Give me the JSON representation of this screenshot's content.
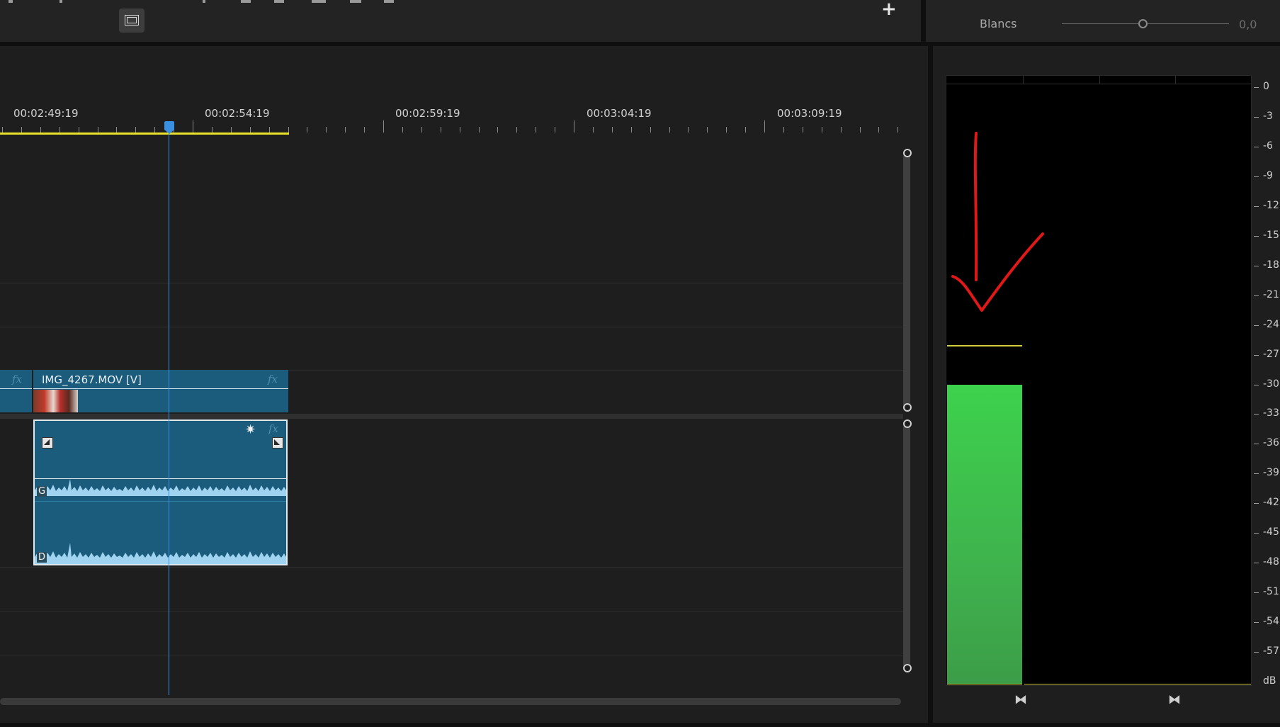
{
  "top_bar": {
    "add_button": "+",
    "lumetri_param": {
      "label": "Blancs",
      "value": "0,0"
    }
  },
  "timeline": {
    "ruler_labels": [
      "00:02:49:19",
      "00:02:54:19",
      "00:02:59:19",
      "00:03:04:19",
      "00:03:09:19"
    ],
    "video_clip": {
      "name": "IMG_4267.MOV [V]",
      "fx_prev": "fx",
      "fx": "fx"
    },
    "audio_clip": {
      "channel_left": "G",
      "channel_right": "D",
      "fx": "fx"
    }
  },
  "audio_meter": {
    "scale_labels": [
      "0",
      "-3",
      "-6",
      "-9",
      "-12",
      "-15",
      "-18",
      "-21",
      "-24",
      "-27",
      "-30",
      "-33",
      "-36",
      "-39",
      "-42",
      "-45",
      "-48",
      "-51",
      "-54",
      "-57",
      "dB"
    ],
    "left_channel_level_db": -30,
    "left_channel_peak_db": -26,
    "right_channel_level_db": null,
    "colors": {
      "level": "#3fcf4f",
      "peak": "#d4cc3a",
      "annotation": "#e01818"
    }
  },
  "colors": {
    "accent": "#3a8fe0",
    "clip": "#1b5c7c",
    "work_area": "#e8e02a"
  }
}
